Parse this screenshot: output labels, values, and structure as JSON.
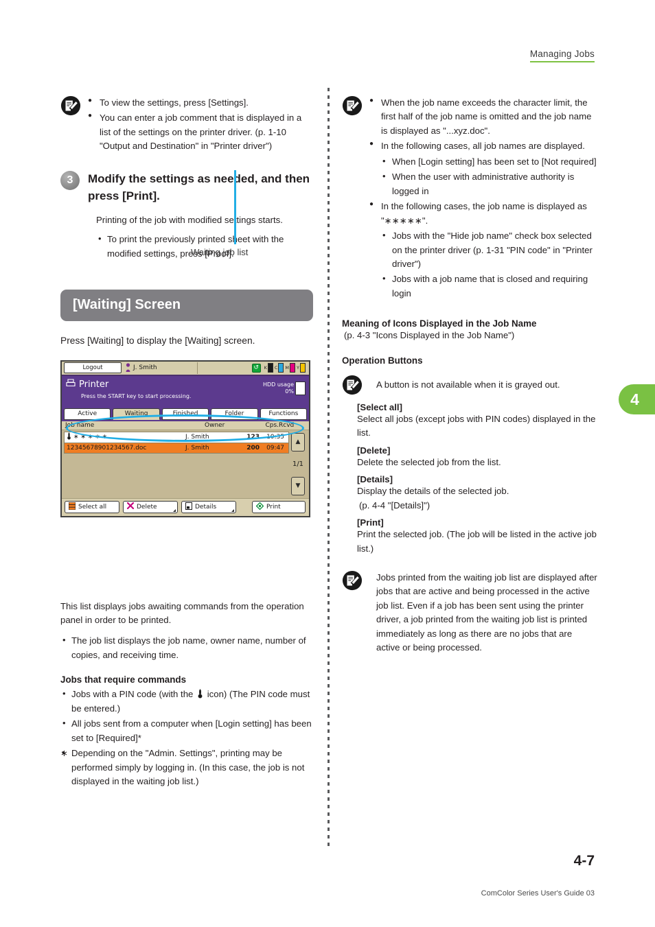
{
  "header": {
    "running_head": "Managing Jobs"
  },
  "chapter_tab": {
    "number": "4"
  },
  "left_column": {
    "note_top": {
      "icon": "note-pencil-icon",
      "bullets": [
        "To view the settings, press [Settings].",
        "You can enter a job comment that is displayed in a list of the settings on the printer driver. (p. 1-10 \"Output and Destination\" in \"Printer driver\")"
      ]
    },
    "step": {
      "number": "3",
      "title": "Modify the settings as needed, and then press [Print].",
      "description": "Printing of the job with modified settings starts.",
      "sub_bullets": [
        "To print the previously printed sheet with the modified settings, press [Proof]."
      ]
    },
    "section": {
      "heading": "[Waiting] Screen",
      "intro": "Press [Waiting] to display the [Waiting] screen."
    },
    "panel": {
      "logout_label": "Logout",
      "user_name": "J. Smith",
      "user_icon": "user-icon",
      "recycle_icon": "recycle-icon",
      "ink": [
        {
          "letter": "K",
          "color": "#1a1a1a"
        },
        {
          "letter": "C",
          "color": "#29a8df"
        },
        {
          "letter": "M",
          "color": "#e4007f"
        },
        {
          "letter": "Y",
          "color": "#f5c400"
        }
      ],
      "title": "Printer",
      "title_icon": "printer-icon",
      "message": "Press the START key to start processing.",
      "hdd_label": "HDD usage",
      "hdd_value": "0%",
      "tabs": [
        {
          "label": "Active",
          "active": false
        },
        {
          "label": "Waiting",
          "active": true
        },
        {
          "label": "Finished",
          "active": false
        },
        {
          "label": "Folder",
          "active": false
        },
        {
          "label": "Functions",
          "active": false
        }
      ],
      "columns": [
        "Job name",
        "Owner",
        "Cps.",
        "Rcvd"
      ],
      "rows": [
        {
          "icon": "pin-lock-icon",
          "name": "∗ ∗ ∗ ∗ ∗",
          "owner": "J. Smith",
          "cps": "123",
          "rcvd": "10:35",
          "selected": false
        },
        {
          "icon": "",
          "name": "12345678901234567.doc",
          "owner": "J. Smith",
          "cps": "200",
          "rcvd": "09:47",
          "selected": true
        }
      ],
      "scroll": {
        "up_icon": "triangle-up-icon",
        "down_icon": "triangle-down-icon",
        "page_indicator": "1/1"
      },
      "buttons": [
        {
          "label": "Select all",
          "icon": "list-lines-icon"
        },
        {
          "label": "Delete",
          "icon": "x-mark-icon"
        },
        {
          "label": "Details",
          "icon": "document-icon"
        },
        {
          "label": "Print",
          "icon": "print-diamond-icon"
        }
      ],
      "callout_label": "Waiting job list"
    },
    "body": {
      "intro": "This list displays jobs awaiting commands from the operation panel in order to be printed.",
      "intro_bullets": [
        "The job list displays the job name, owner name, number of copies, and receiving time."
      ],
      "commands_heading": "Jobs that require commands",
      "commands_bullet_1_before": "Jobs with a PIN code (with the",
      "commands_bullet_1_after": "icon) (The PIN code must be entered.)",
      "commands_bullet_2": "All jobs sent from a computer when [Login setting] has been set to [Required]*",
      "footnote_marker": "∗",
      "footnote_text": "Depending on the \"Admin. Settings\", printing may be performed simply by logging in. (In this case, the job is not displayed in the waiting job list.)"
    }
  },
  "right_column": {
    "note_top": {
      "icon": "note-pencil-icon",
      "bullets": [
        {
          "text": "When the job name exceeds the character limit, the first half of the job name is omitted and the job name is displayed as \"...xyz.doc\".",
          "sub": []
        },
        {
          "text": "In the following cases, all job names are displayed.",
          "sub": [
            "When [Login setting] has been set to [Not required]",
            "When the user with administrative authority is logged in"
          ]
        },
        {
          "text": "In the following cases, the job name is displayed as \"∗∗∗∗∗\".",
          "sub": [
            "Jobs with the \"Hide job name\" check box selected on the printer driver (p. 1-31 \"PIN code\" in \"Printer driver\")",
            "Jobs with a job name that is closed and requiring login"
          ]
        }
      ]
    },
    "icons_heading": "Meaning of Icons Displayed in the Job Name",
    "icons_ref": "(p. 4-3 \"Icons Displayed in the Job Name\")",
    "operation_heading": "Operation Buttons",
    "operation_note": "A button is not available when it is grayed out.",
    "operation_note_icon": "note-pencil-icon",
    "button_defs": [
      {
        "term": "[Select all]",
        "def": "Select all jobs (except jobs with PIN codes) displayed in the list."
      },
      {
        "term": "[Delete]",
        "def": "Delete the selected job from the list."
      },
      {
        "term": "[Details]",
        "def": "Display the details of the selected job."
      },
      {
        "term": "[Print]",
        "def": "Print the selected job. (The job will be listed in the active job list.)"
      }
    ],
    "details_ref": "(p. 4-4 \"[Details]\")",
    "note_bottom": {
      "icon": "note-pencil-icon",
      "text": "Jobs printed from the waiting job list are displayed after jobs that are active and being processed in the active job list. Even if a job has been sent using the printer driver, a job printed from the waiting job list is printed immediately as long as there are no jobs that are active or being processed."
    }
  },
  "footer": {
    "page_number": "4-7",
    "guide_title": "ComColor Series User's Guide 03"
  }
}
